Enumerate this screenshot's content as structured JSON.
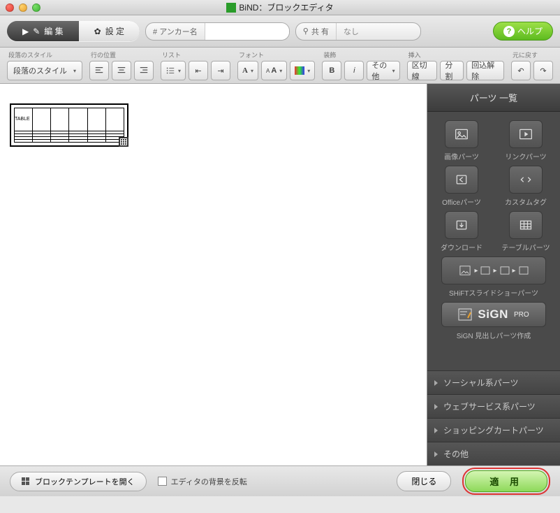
{
  "window": {
    "title": "BiND：ブロックエディタ"
  },
  "tabs": {
    "edit": "編 集",
    "settings": "設 定"
  },
  "anchor": {
    "label": "# アンカー名",
    "value": ""
  },
  "share": {
    "label": "共 有",
    "value": "なし"
  },
  "help": {
    "label": "ヘルプ"
  },
  "groups": {
    "paragraph_style": "段落のスタイル",
    "align": "行の位置",
    "list": "リスト",
    "font": "フォント",
    "decoration": "装飾",
    "insert": "挿入",
    "undo": "元に戻す"
  },
  "style_dd": "段落のスタイル",
  "deco_other": "その他",
  "insert_btns": {
    "sep": "区切線",
    "split": "分割",
    "unwrap": "回込解除"
  },
  "canvas": {
    "table_caption": "TABLE"
  },
  "side": {
    "header": "パーツ 一覧",
    "parts": {
      "image": "画像パーツ",
      "link": "リンクパーツ",
      "office": "Officeパーツ",
      "custom": "カスタムタグ",
      "download": "ダウンロード",
      "table": "テーブルパーツ",
      "shift": "SHiFTスライドショーパーツ",
      "sign_label": "SiGN 見出しパーツ作成",
      "sign_brand": "SiGN",
      "sign_pro": "PRO"
    },
    "accordion": {
      "social": "ソーシャル系パーツ",
      "web": "ウェブサービス系パーツ",
      "cart": "ショッピングカートパーツ",
      "other": "その他"
    }
  },
  "footer": {
    "template": "ブロックテンプレートを開く",
    "invert": "エディタの背景を反転",
    "cancel": "閉じる",
    "apply": "適 用"
  }
}
